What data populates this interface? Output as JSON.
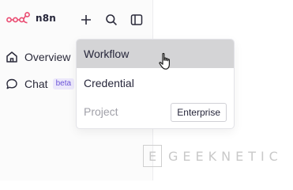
{
  "brand": {
    "name": "n8n",
    "accent_color": "#ea4b71"
  },
  "toolbar": {
    "add_icon": "plus-icon",
    "search_icon": "search-icon",
    "panel_icon": "sidebar-toggle-icon"
  },
  "sidebar": {
    "items": [
      {
        "label": "Overview",
        "icon": "home-icon"
      },
      {
        "label": "Chat",
        "icon": "chat-bubble-icon",
        "badge": "beta"
      }
    ]
  },
  "create_menu": {
    "items": [
      {
        "label": "Workflow",
        "state": "hovered"
      },
      {
        "label": "Credential",
        "state": "normal"
      },
      {
        "label": "Project",
        "state": "disabled",
        "badge": "Enterprise"
      }
    ]
  },
  "watermark": {
    "letter": "E",
    "text": "GEEKNETIC"
  }
}
